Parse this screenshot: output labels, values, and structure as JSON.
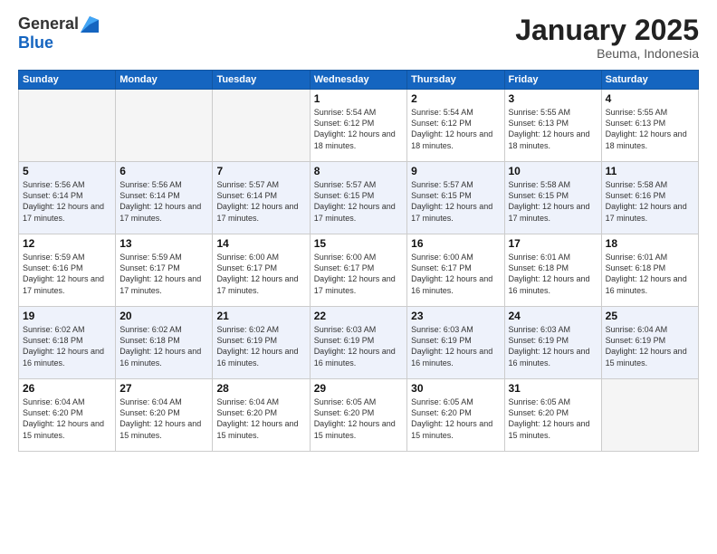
{
  "logo": {
    "general": "General",
    "blue": "Blue"
  },
  "header": {
    "month": "January 2025",
    "location": "Beuma, Indonesia"
  },
  "weekdays": [
    "Sunday",
    "Monday",
    "Tuesday",
    "Wednesday",
    "Thursday",
    "Friday",
    "Saturday"
  ],
  "weeks": [
    [
      {
        "day": "",
        "info": ""
      },
      {
        "day": "",
        "info": ""
      },
      {
        "day": "",
        "info": ""
      },
      {
        "day": "1",
        "info": "Sunrise: 5:54 AM\nSunset: 6:12 PM\nDaylight: 12 hours\nand 18 minutes."
      },
      {
        "day": "2",
        "info": "Sunrise: 5:54 AM\nSunset: 6:12 PM\nDaylight: 12 hours\nand 18 minutes."
      },
      {
        "day": "3",
        "info": "Sunrise: 5:55 AM\nSunset: 6:13 PM\nDaylight: 12 hours\nand 18 minutes."
      },
      {
        "day": "4",
        "info": "Sunrise: 5:55 AM\nSunset: 6:13 PM\nDaylight: 12 hours\nand 18 minutes."
      }
    ],
    [
      {
        "day": "5",
        "info": "Sunrise: 5:56 AM\nSunset: 6:14 PM\nDaylight: 12 hours\nand 17 minutes."
      },
      {
        "day": "6",
        "info": "Sunrise: 5:56 AM\nSunset: 6:14 PM\nDaylight: 12 hours\nand 17 minutes."
      },
      {
        "day": "7",
        "info": "Sunrise: 5:57 AM\nSunset: 6:14 PM\nDaylight: 12 hours\nand 17 minutes."
      },
      {
        "day": "8",
        "info": "Sunrise: 5:57 AM\nSunset: 6:15 PM\nDaylight: 12 hours\nand 17 minutes."
      },
      {
        "day": "9",
        "info": "Sunrise: 5:57 AM\nSunset: 6:15 PM\nDaylight: 12 hours\nand 17 minutes."
      },
      {
        "day": "10",
        "info": "Sunrise: 5:58 AM\nSunset: 6:15 PM\nDaylight: 12 hours\nand 17 minutes."
      },
      {
        "day": "11",
        "info": "Sunrise: 5:58 AM\nSunset: 6:16 PM\nDaylight: 12 hours\nand 17 minutes."
      }
    ],
    [
      {
        "day": "12",
        "info": "Sunrise: 5:59 AM\nSunset: 6:16 PM\nDaylight: 12 hours\nand 17 minutes."
      },
      {
        "day": "13",
        "info": "Sunrise: 5:59 AM\nSunset: 6:17 PM\nDaylight: 12 hours\nand 17 minutes."
      },
      {
        "day": "14",
        "info": "Sunrise: 6:00 AM\nSunset: 6:17 PM\nDaylight: 12 hours\nand 17 minutes."
      },
      {
        "day": "15",
        "info": "Sunrise: 6:00 AM\nSunset: 6:17 PM\nDaylight: 12 hours\nand 17 minutes."
      },
      {
        "day": "16",
        "info": "Sunrise: 6:00 AM\nSunset: 6:17 PM\nDaylight: 12 hours\nand 16 minutes."
      },
      {
        "day": "17",
        "info": "Sunrise: 6:01 AM\nSunset: 6:18 PM\nDaylight: 12 hours\nand 16 minutes."
      },
      {
        "day": "18",
        "info": "Sunrise: 6:01 AM\nSunset: 6:18 PM\nDaylight: 12 hours\nand 16 minutes."
      }
    ],
    [
      {
        "day": "19",
        "info": "Sunrise: 6:02 AM\nSunset: 6:18 PM\nDaylight: 12 hours\nand 16 minutes."
      },
      {
        "day": "20",
        "info": "Sunrise: 6:02 AM\nSunset: 6:18 PM\nDaylight: 12 hours\nand 16 minutes."
      },
      {
        "day": "21",
        "info": "Sunrise: 6:02 AM\nSunset: 6:19 PM\nDaylight: 12 hours\nand 16 minutes."
      },
      {
        "day": "22",
        "info": "Sunrise: 6:03 AM\nSunset: 6:19 PM\nDaylight: 12 hours\nand 16 minutes."
      },
      {
        "day": "23",
        "info": "Sunrise: 6:03 AM\nSunset: 6:19 PM\nDaylight: 12 hours\nand 16 minutes."
      },
      {
        "day": "24",
        "info": "Sunrise: 6:03 AM\nSunset: 6:19 PM\nDaylight: 12 hours\nand 16 minutes."
      },
      {
        "day": "25",
        "info": "Sunrise: 6:04 AM\nSunset: 6:19 PM\nDaylight: 12 hours\nand 15 minutes."
      }
    ],
    [
      {
        "day": "26",
        "info": "Sunrise: 6:04 AM\nSunset: 6:20 PM\nDaylight: 12 hours\nand 15 minutes."
      },
      {
        "day": "27",
        "info": "Sunrise: 6:04 AM\nSunset: 6:20 PM\nDaylight: 12 hours\nand 15 minutes."
      },
      {
        "day": "28",
        "info": "Sunrise: 6:04 AM\nSunset: 6:20 PM\nDaylight: 12 hours\nand 15 minutes."
      },
      {
        "day": "29",
        "info": "Sunrise: 6:05 AM\nSunset: 6:20 PM\nDaylight: 12 hours\nand 15 minutes."
      },
      {
        "day": "30",
        "info": "Sunrise: 6:05 AM\nSunset: 6:20 PM\nDaylight: 12 hours\nand 15 minutes."
      },
      {
        "day": "31",
        "info": "Sunrise: 6:05 AM\nSunset: 6:20 PM\nDaylight: 12 hours\nand 15 minutes."
      },
      {
        "day": "",
        "info": ""
      }
    ]
  ]
}
